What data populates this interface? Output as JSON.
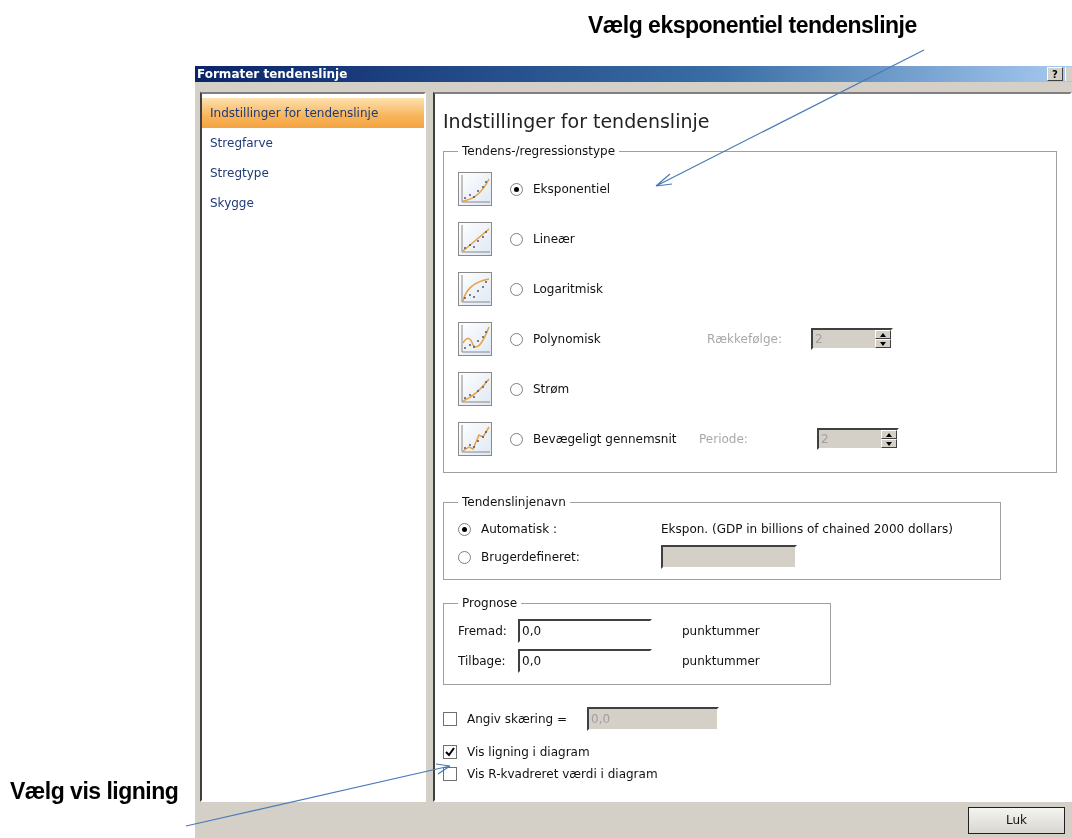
{
  "annotations": [
    {
      "kind": "top",
      "text": "Vælg eksponentiel tendenslinje"
    },
    {
      "kind": "bottom",
      "text": "Vælg vis ligning"
    }
  ],
  "window": {
    "title": "Formater tendenslinje",
    "help": "?"
  },
  "sidebar": {
    "items": [
      {
        "label": "Indstillinger for tendenslinje",
        "selected": true
      },
      {
        "label": "Stregfarve",
        "selected": false
      },
      {
        "label": "Stregtype",
        "selected": false
      },
      {
        "label": "Skygge",
        "selected": false
      }
    ]
  },
  "panel": {
    "heading": "Indstillinger for tendenslinje",
    "trend_type": {
      "legend": "Tendens-/regressionstype",
      "options": [
        {
          "kind": "exponential",
          "label": "Eksponentiel",
          "selected": true
        },
        {
          "kind": "linear",
          "label": "Lineær",
          "selected": false
        },
        {
          "kind": "logarithmic",
          "label": "Logaritmisk",
          "selected": false
        },
        {
          "kind": "polynomial",
          "label": "Polynomisk",
          "selected": false,
          "param": {
            "label": "Rækkefølge:",
            "value": "2",
            "disabled": true
          }
        },
        {
          "kind": "power",
          "label": "Strøm",
          "selected": false
        },
        {
          "kind": "moving_average",
          "label": "Bevægeligt gennemsnit",
          "selected": false,
          "param": {
            "label": "Periode:",
            "value": "2",
            "disabled": true
          }
        }
      ]
    },
    "name": {
      "legend": "Tendenslinjenavn",
      "options": [
        {
          "label": "Automatisk :",
          "selected": true,
          "value": "Ekspon. (GDP in billions of chained 2000 dollars)"
        },
        {
          "label": "Brugerdefineret:",
          "selected": false,
          "field_disabled": true
        }
      ]
    },
    "forecast": {
      "legend": "Prognose",
      "rows": [
        {
          "label": "Fremad:",
          "value": "0,0",
          "unit": "punktummer"
        },
        {
          "label": "Tilbage:",
          "value": "0,0",
          "unit": "punktummer"
        }
      ]
    },
    "checks": [
      {
        "label": "Angiv skæring =",
        "checked": false,
        "field": {
          "value": "0,0",
          "disabled": true
        }
      },
      {
        "label": "Vis ligning i diagram",
        "checked": true
      },
      {
        "label": "Vis R-kvadreret værdi i diagram",
        "checked": false
      }
    ]
  },
  "buttons": [
    {
      "label": "Luk"
    }
  ]
}
